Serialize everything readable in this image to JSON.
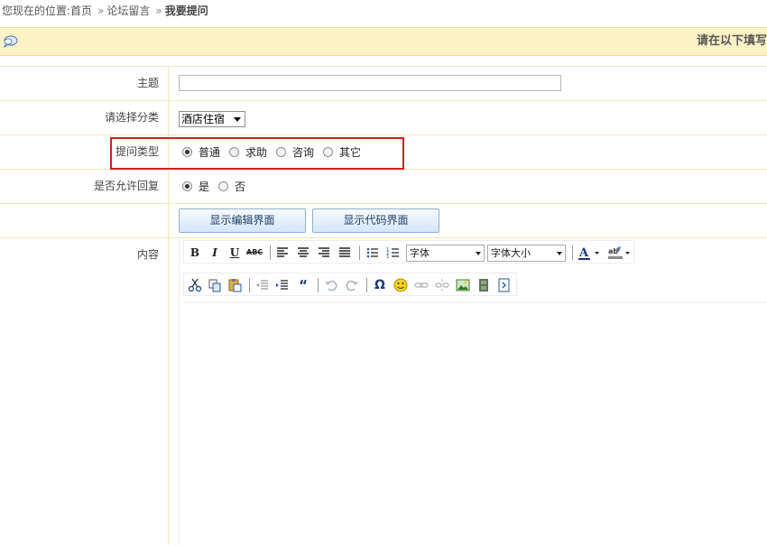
{
  "breadcrumb": {
    "prefix": "您现在的位置:",
    "items": [
      "首页",
      "论坛留言",
      "我要提问"
    ],
    "separator": "»"
  },
  "banner": {
    "title": "请在以下填写"
  },
  "form": {
    "subject": {
      "label": "主题",
      "value": ""
    },
    "category": {
      "label": "请选择分类",
      "selected": "酒店住宿"
    },
    "question_type": {
      "label": "提问类型",
      "options": [
        "普通",
        "求助",
        "咨询",
        "其它"
      ],
      "selected_index": 0
    },
    "allow_reply": {
      "label": "是否允许回复",
      "options": [
        "是",
        "否"
      ],
      "selected_index": 0
    },
    "buttons": {
      "show_editor": "显示编辑界面",
      "show_code": "显示代码界面"
    },
    "content": {
      "label": "内容"
    }
  },
  "editor": {
    "font_select": "字体",
    "size_select": "字体大小",
    "toolbar_row1": [
      "bold-icon",
      "italic-icon",
      "underline-icon",
      "strikethrough-icon",
      "align-left-icon",
      "align-center-icon",
      "align-right-icon",
      "align-justify-icon",
      "bulleted-list-icon",
      "numbered-list-icon",
      "font-color-icon",
      "highlight-color-icon"
    ],
    "toolbar_row2": [
      "cut-icon",
      "copy-icon",
      "paste-icon",
      "outdent-icon",
      "indent-icon",
      "blockquote-icon",
      "undo-icon",
      "redo-icon",
      "special-char-icon",
      "smiley-icon",
      "link-icon",
      "unlink-icon",
      "image-icon",
      "media-icon",
      "source-icon"
    ]
  },
  "colors": {
    "banner_bg": "#fdf2c6",
    "highlight_border": "#d21e1e",
    "button_text": "#1f3d66"
  }
}
